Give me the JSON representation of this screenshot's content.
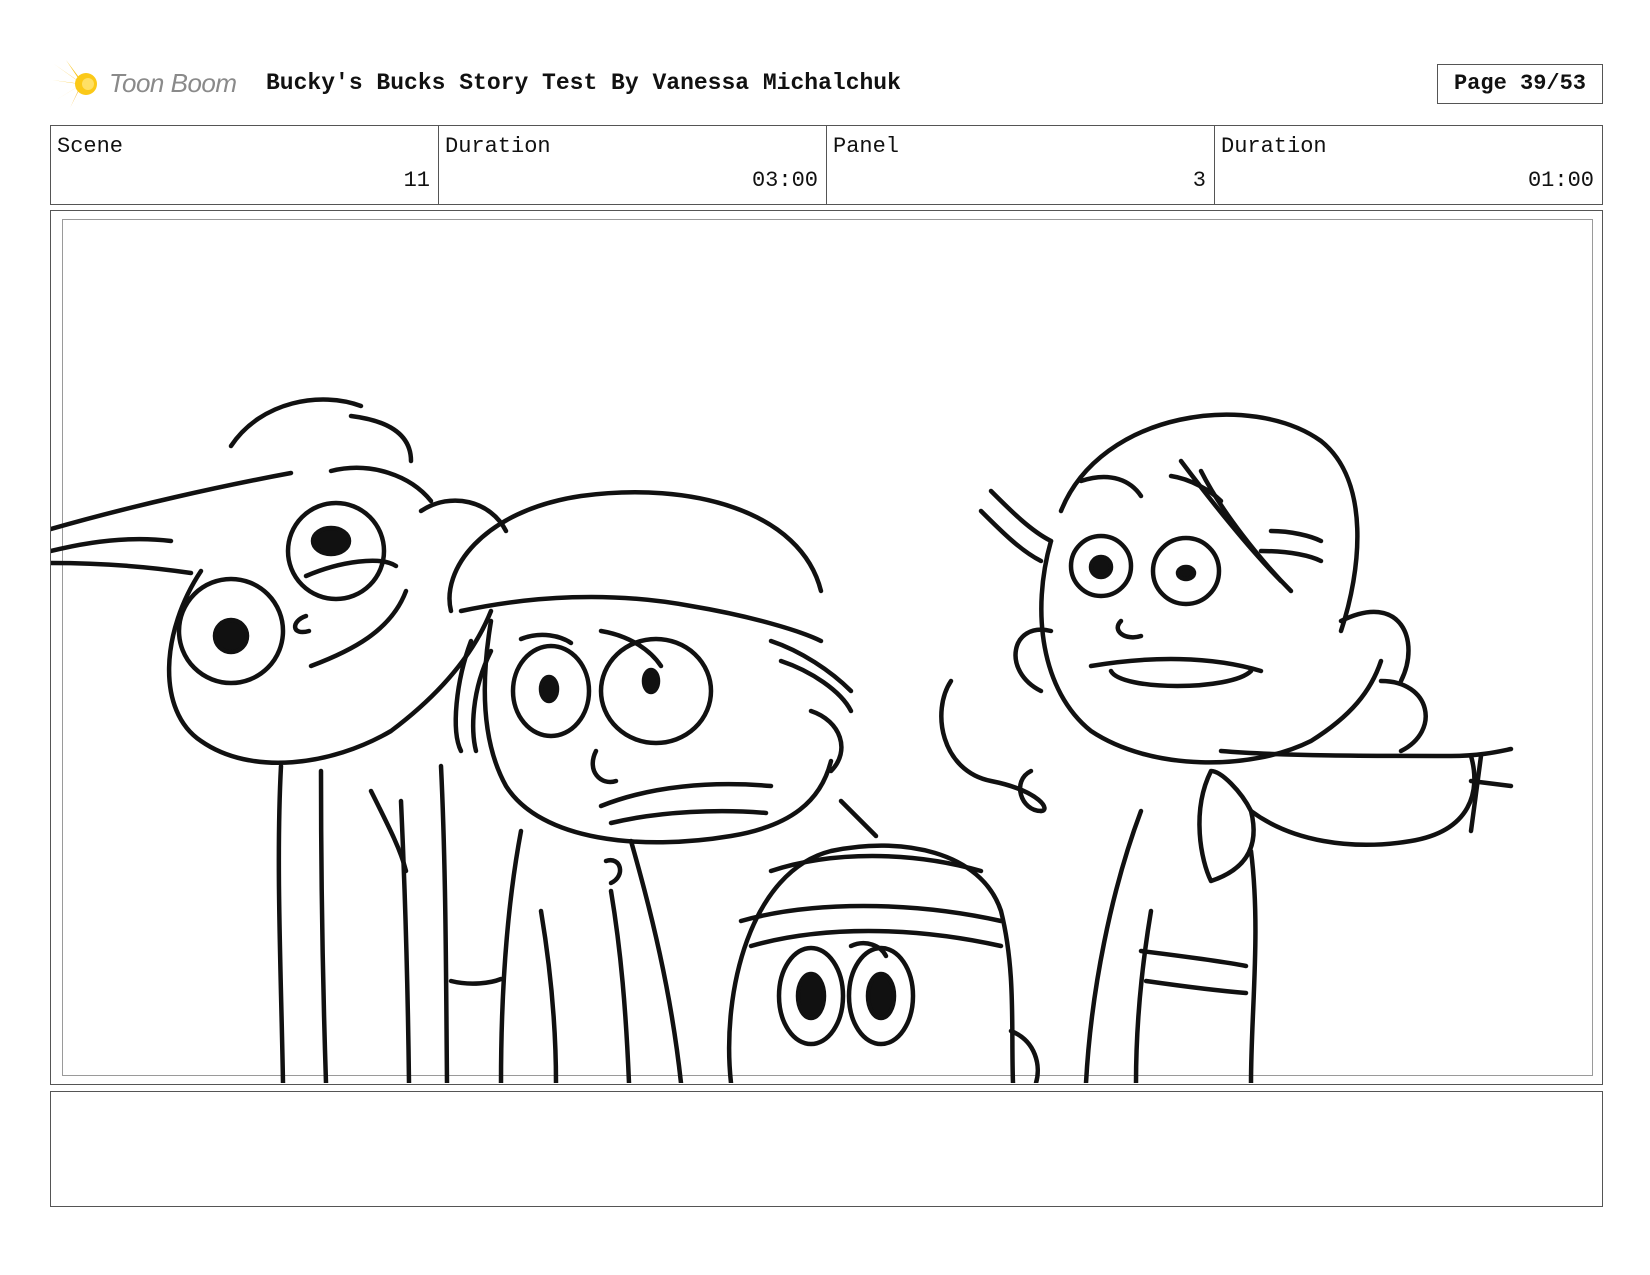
{
  "header": {
    "logo_text": "Toon Boom",
    "title": "Bucky's Bucks Story Test  By Vanessa Michalchuk",
    "page": "Page 39/53"
  },
  "info": {
    "scene_label": "Scene",
    "scene_value": "11",
    "scene_duration_label": "Duration",
    "scene_duration_value": "03:00",
    "panel_label": "Panel",
    "panel_value": "3",
    "panel_duration_label": "Duration",
    "panel_duration_value": "01:00"
  },
  "panel": {
    "image": "storyboard-sketch-four-kids"
  },
  "notes": {
    "text": ""
  }
}
